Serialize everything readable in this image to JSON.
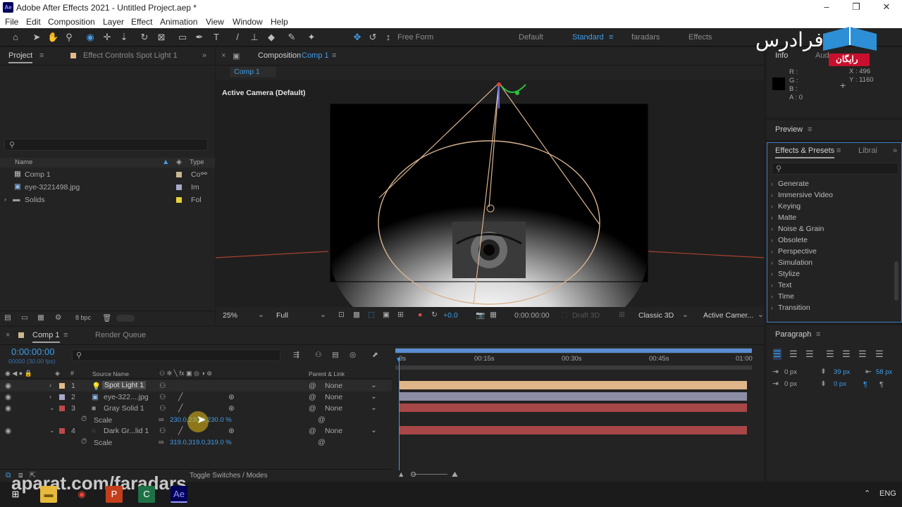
{
  "window": {
    "app_icon": "Ae",
    "title": "Adobe After Effects 2021 - Untitled Project.aep *",
    "controls": [
      "–",
      "❐",
      "✕"
    ]
  },
  "menu": [
    "File",
    "Edit",
    "Composition",
    "Layer",
    "Effect",
    "Animation",
    "View",
    "Window",
    "Help"
  ],
  "toolbar": {
    "free_form": "Free Form",
    "workspaces": [
      "Default",
      "Standard",
      "faradars",
      "Effects"
    ]
  },
  "watermark": {
    "brand": "فرادرس",
    "badge": "رایگان",
    "url": "aparat.com/faradars"
  },
  "project_panel": {
    "tab_project": "Project",
    "tab_effect_controls": "Effect Controls Spot Light 1",
    "col_name": "Name",
    "col_type": "Type",
    "items": [
      {
        "name": "Comp 1",
        "type": "Co",
        "color": "#c9b88f"
      },
      {
        "name": "eye-3221498.jpg",
        "type": "Im",
        "color": "#a8a8c8"
      },
      {
        "name": "Solids",
        "type": "Fol",
        "color": "#e6d23c"
      }
    ],
    "bpc": "8 bpc"
  },
  "composition_panel": {
    "tab_label": "Composition",
    "tab_comp": "Comp 1",
    "breadcrumb": "Comp 1",
    "camera_label": "Active Camera (Default)",
    "zoom": "25%",
    "resolution": "Full",
    "exposure": "+0.0",
    "timecode": "0:00:00:00",
    "draft3d": "Draft 3D",
    "renderer": "Classic 3D",
    "view": "Active Camer..."
  },
  "info_panel": {
    "tab_info": "Info",
    "tab_audio": "Aud",
    "r": "R :",
    "g": "G :",
    "b": "B :",
    "a": "A : 0",
    "x": "X : 496",
    "y": "Y : 1160"
  },
  "preview_panel": {
    "title": "Preview"
  },
  "effects_panel": {
    "tab": "Effects & Presets",
    "tab_library": "Librai",
    "items": [
      "Generate",
      "Immersive Video",
      "Keying",
      "Matte",
      "Noise & Grain",
      "Obsolete",
      "Perspective",
      "Simulation",
      "Stylize",
      "Text",
      "Time",
      "Transition"
    ]
  },
  "timeline": {
    "tab_comp": "Comp 1",
    "tab_render": "Render Queue",
    "timecode": "0:00:00:00",
    "fps": "00000 (30.00 fps)",
    "col_source": "Source Name",
    "col_parent": "Parent & Link",
    "ruler": [
      "0s",
      "00:15s",
      "00:30s",
      "00:45s",
      "01:00"
    ],
    "layers": [
      {
        "num": "1",
        "name": "Spot Light 1",
        "parent": "None",
        "color": "#e4b98a",
        "bar": "#e0b58a"
      },
      {
        "num": "2",
        "name": "eye-322....jpg",
        "parent": "None",
        "color": "#a8a8c8",
        "bar": "#8d8ea6"
      },
      {
        "num": "3",
        "name": "Gray Solid 1",
        "parent": "None",
        "color": "#c24848",
        "bar": "#a84747"
      },
      {
        "num": "4",
        "name": "Dark Gr...lid 1",
        "parent": "None",
        "color": "#c24848",
        "bar": "#a84747"
      }
    ],
    "scale_label": "Scale",
    "scale3": "230.0,230.0,230.0 %",
    "scale4": "319.0,319.0,319.0 %",
    "toggle": "Toggle Switches / Modes"
  },
  "paragraph_panel": {
    "title": "Paragraph",
    "indent_left": "0 px",
    "indent_first": "0 px",
    "space_before": "39 px",
    "space_after": "0 px",
    "indent_right": "58 px"
  },
  "taskbar": {
    "lang": "ENG"
  }
}
